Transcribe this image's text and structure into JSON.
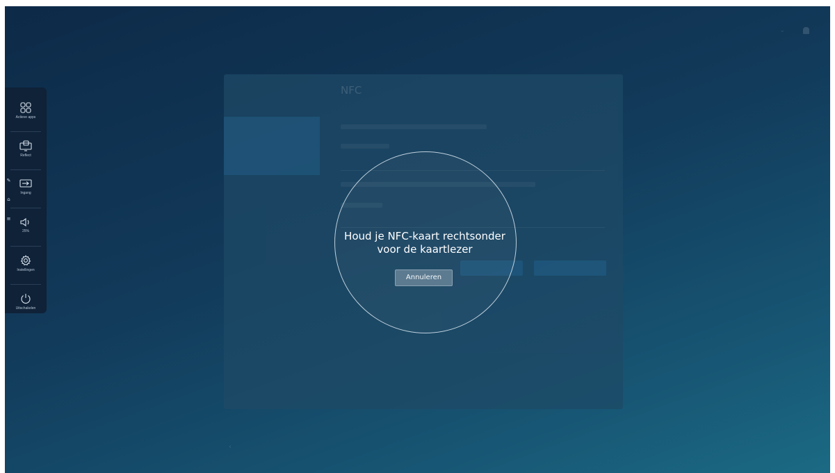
{
  "topbar": {
    "items": [
      "",
      ""
    ],
    "bell_icon": "bell-icon"
  },
  "dock": {
    "items": [
      {
        "label": "Actieve apps",
        "icon": "apps-grid-icon"
      },
      {
        "label": "Reflect",
        "icon": "screen-mirror-icon"
      },
      {
        "label": "Ingang",
        "icon": "input-source-icon"
      },
      {
        "label": "25%",
        "icon": "speaker-icon"
      },
      {
        "label": "Instellingen",
        "icon": "gear-icon"
      },
      {
        "label": "Uitschakelen",
        "icon": "power-icon"
      }
    ],
    "side_tabs": [
      "pen-icon",
      "home-icon",
      "menu-icon"
    ]
  },
  "settings_panel": {
    "title": "NFC",
    "nav_items": [
      "",
      "",
      "",
      "",
      "",
      "",
      "",
      "",
      ""
    ],
    "active_nav_index": 2
  },
  "nfc_dialog": {
    "message": "Houd je NFC-kaart rechtsonder voor de kaartlezer",
    "cancel_label": "Annuleren"
  },
  "colors": {
    "background_dark": "#0d2a48",
    "background_light": "#1b6a84",
    "dock_bg": "#0f2238",
    "cancel_button": "#5c7a90"
  }
}
